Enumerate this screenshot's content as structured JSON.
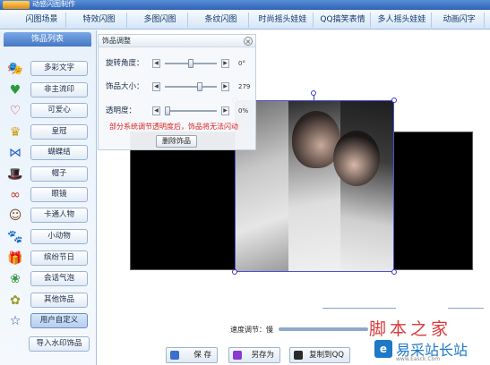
{
  "window": {
    "title": "动感闪图制作"
  },
  "top_tabs": [
    "闪图场景",
    "特效闪图",
    "多图闪图",
    "条纹闪图",
    "时尚摇头娃娃",
    "QQ搞笑表情",
    "多人摇头娃娃",
    "动画闪字"
  ],
  "sidebar": {
    "header": "饰品列表",
    "items": [
      {
        "label": "多彩文字",
        "icon": "colorful-text-icon",
        "glyph": "🎭",
        "color": "#d23a6a"
      },
      {
        "label": "非主流印",
        "icon": "heart-stamp-icon",
        "glyph": "♥",
        "color": "#2b9a3a"
      },
      {
        "label": "可爱心",
        "icon": "cute-heart-icon",
        "glyph": "♡",
        "color": "#e0354d"
      },
      {
        "label": "皇冠",
        "icon": "crown-icon",
        "glyph": "♛",
        "color": "#d0a010"
      },
      {
        "label": "蝴蝶结",
        "icon": "bow-icon",
        "glyph": "⋈",
        "color": "#2b5fcf"
      },
      {
        "label": "帽子",
        "icon": "hat-icon",
        "glyph": "🎩",
        "color": "#444444"
      },
      {
        "label": "眼镜",
        "icon": "glasses-icon",
        "glyph": "∞",
        "color": "#c0392b"
      },
      {
        "label": "卡通人物",
        "icon": "cartoon-figure-icon",
        "glyph": "☺",
        "color": "#7a4a20"
      },
      {
        "label": "小动物",
        "icon": "animal-icon",
        "glyph": "🐾",
        "color": "#b07030"
      },
      {
        "label": "缤纷节日",
        "icon": "gift-icon",
        "glyph": "🎁",
        "color": "#7a2ab0"
      },
      {
        "label": "会话气泡",
        "icon": "speech-bubble-icon",
        "glyph": "❀",
        "color": "#3a9a4a"
      },
      {
        "label": "其他饰品",
        "icon": "misc-decoration-icon",
        "glyph": "✿",
        "color": "#9a9a2a"
      },
      {
        "label": "用户自定义",
        "icon": "star-icon",
        "glyph": "☆",
        "color": "#2a4aa0"
      },
      {
        "label": "导入水印饰品",
        "icon": "",
        "glyph": "",
        "color": ""
      }
    ]
  },
  "panel": {
    "title": "饰品调整",
    "close": "×",
    "rotation": {
      "label": "旋转角度：",
      "value": "0°",
      "level": 0.5
    },
    "size": {
      "label": "饰品大小：",
      "value": "279",
      "level": 0.7
    },
    "opacity": {
      "label": "透明度：",
      "value": "0%",
      "level": 0.0
    },
    "warning": "部分系统调节透明度后，饰品将无法闪动",
    "delete_button": "删除饰品"
  },
  "speed": {
    "label": "速度调节：慢"
  },
  "bottom_buttons": [
    {
      "label": "保 存",
      "icon": "save-icon",
      "color": "#3a6fd0"
    },
    {
      "label": "另存为",
      "icon": "save-as-icon",
      "color": "#8a3ad0"
    },
    {
      "label": "复制到QQ",
      "icon": "qq-icon",
      "color": "#2a2a2a"
    }
  ],
  "watermark": {
    "text1": "脚本之家",
    "logo": "e",
    "text2": "易采站长站",
    "url": "www.Easck.Com"
  }
}
